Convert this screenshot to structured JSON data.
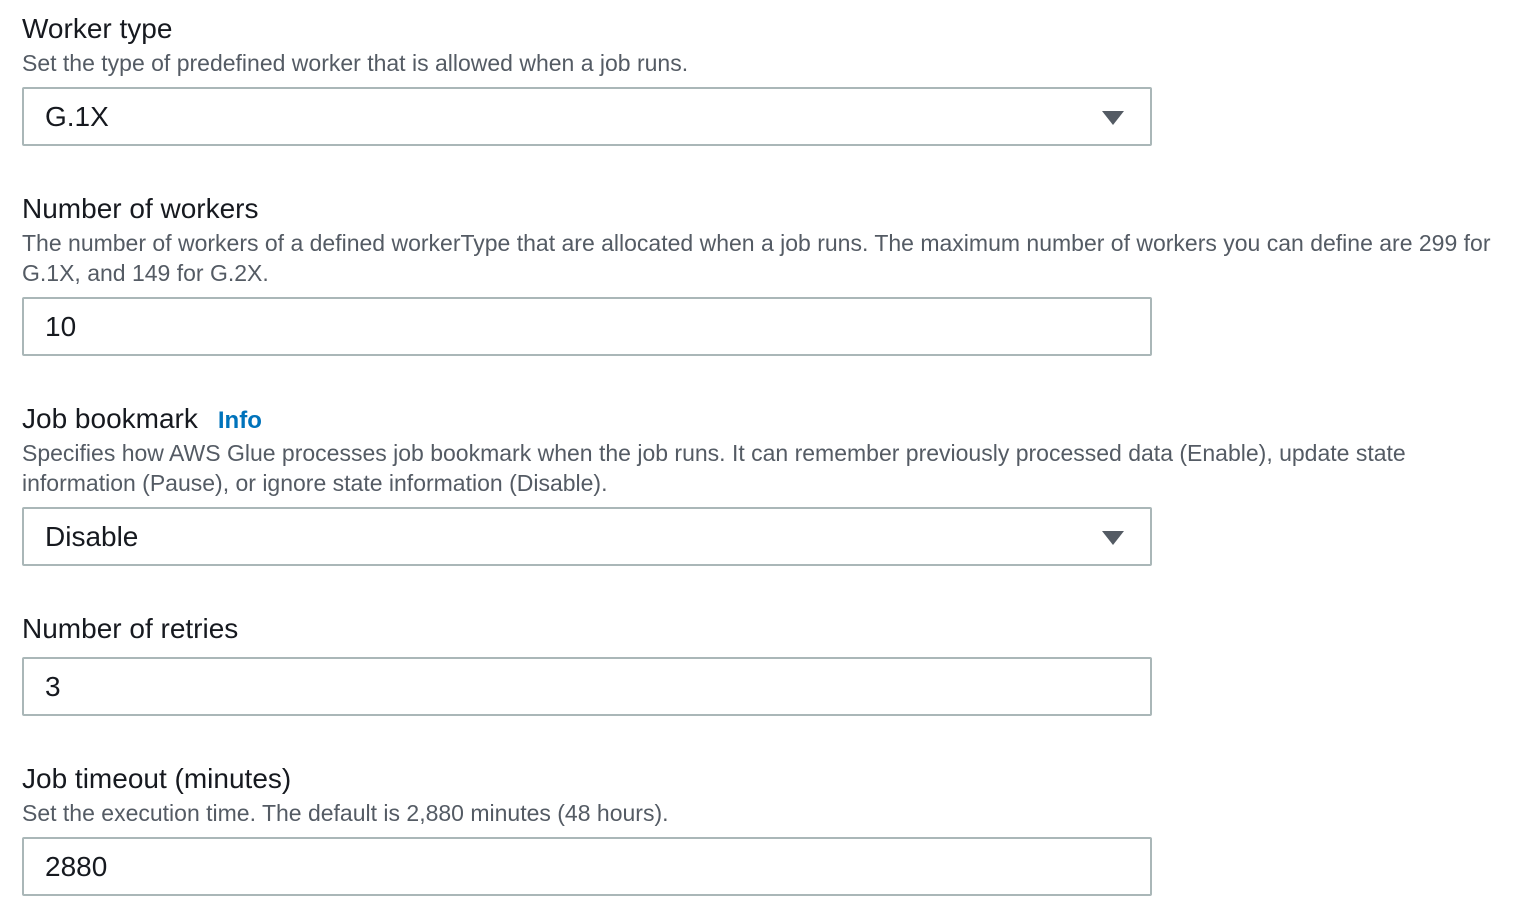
{
  "worker_type": {
    "label": "Worker type",
    "description": "Set the type of predefined worker that is allowed when a job runs.",
    "selected": "G.1X"
  },
  "number_of_workers": {
    "label": "Number of workers",
    "description": "The number of workers of a defined workerType that are allocated when a job runs. The maximum number of workers you can define are 299 for G.1X, and 149 for G.2X.",
    "value": "10"
  },
  "job_bookmark": {
    "label": "Job bookmark",
    "info_label": "Info",
    "description": "Specifies how AWS Glue processes job bookmark when the job runs. It can remember previously processed data (Enable), update state information (Pause), or ignore state information (Disable).",
    "selected": "Disable"
  },
  "number_of_retries": {
    "label": "Number of retries",
    "value": "3"
  },
  "job_timeout": {
    "label": "Job timeout (minutes)",
    "description": "Set the execution time. The default is 2,880 minutes (48 hours).",
    "value": "2880"
  },
  "colors": {
    "text": "#16191f",
    "secondary_text": "#545b64",
    "border": "#aab7b8",
    "link": "#0073bb"
  },
  "icons": {
    "dropdown": "caret-down-icon"
  }
}
